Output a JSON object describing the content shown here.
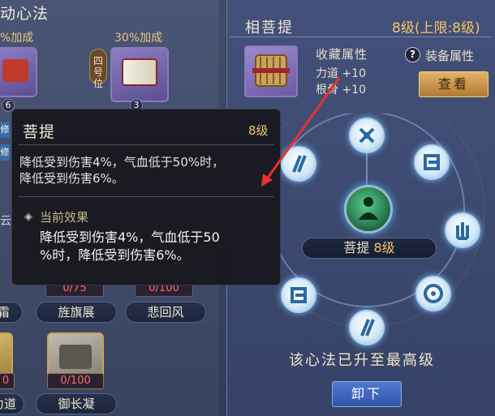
{
  "left": {
    "title": "动心法",
    "bonus_left": "%加成",
    "bonus_right": "30%加成",
    "slot_tag": "四号位",
    "card_badge_1": "6",
    "card_badge_2": "3",
    "side_tab_1": "修",
    "side_tab_2": "修",
    "side_tab_3": "云",
    "progress_1": "0/75",
    "progress_2": "0/100",
    "progress_3": "0/100",
    "progress_4": "0",
    "name_1": "霜",
    "name_2": "旌旗展",
    "name_3": "悲回风",
    "name_4": "力道",
    "name_5": "御长凝"
  },
  "detail": {
    "title": "相菩提",
    "level": "8级(上限:8级)",
    "collection_label": "收藏属性",
    "stat_1": "力道 +10",
    "stat_2": "根骨 +10",
    "help_icon": "?",
    "equip_label": "装备属性",
    "view_button": "查看",
    "skill_name": "菩提",
    "skill_level": "8级",
    "max_text": "该心法已升至最高级",
    "unequip_button": "卸下"
  },
  "tooltip": {
    "title": "菩提",
    "level": "8级",
    "desc_line_1": "降低受到伤害4%，气血低于50%时，",
    "desc_line_2": "降低受到伤害6%。",
    "effect_label": "当前效果",
    "effect_line_1": "降低受到伤害4%，气血低于50",
    "effect_line_2": "%时，降低受到伤害6%。"
  },
  "colors": {
    "accent_gold": "#f1c56a",
    "annotation_red": "#e8322e",
    "node_glow": "#7fc3ff"
  }
}
